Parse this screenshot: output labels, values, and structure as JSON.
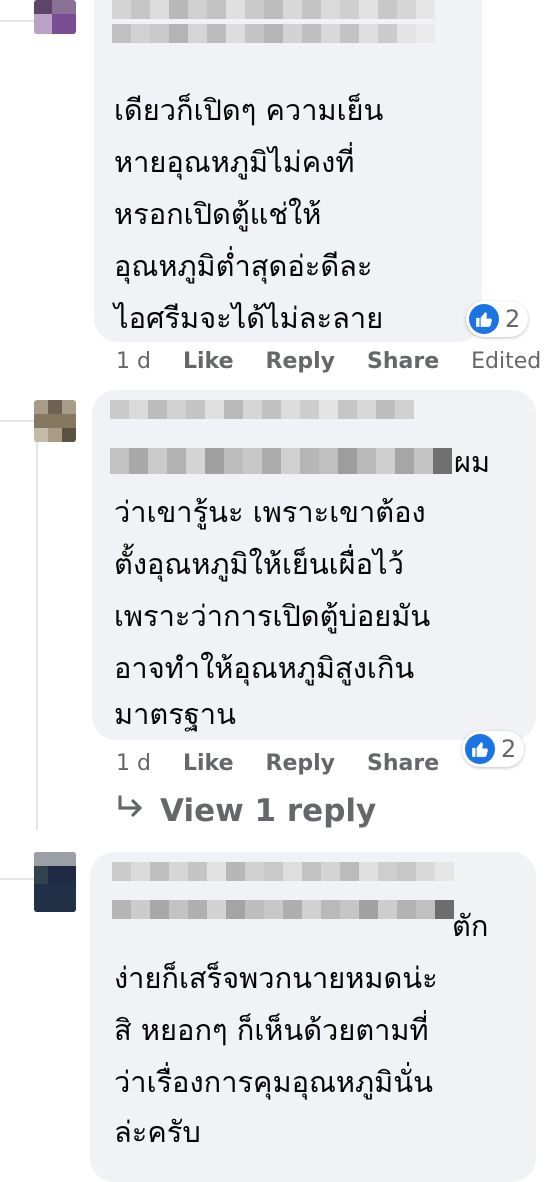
{
  "comments": [
    {
      "name_blurred": true,
      "text_lines": [
        "เดียวก็เปิดๆ ความเย็น",
        "หายอุณหภูมิไม่คงที่",
        "หรอกเปิดตู้แช่ให้",
        "อุณหภูมิต่ำสุดอ่ะดีละ",
        "ไอศรีมจะได้ไม่ละลาย"
      ],
      "reaction_count": "2",
      "reaction_icon": "like-icon",
      "time": "1 d",
      "like_label": "Like",
      "reply_label": "Reply",
      "share_label": "Share",
      "edited_label": "Edited"
    },
    {
      "name_blurred": true,
      "inline_word": "ผม",
      "text_lines": [
        "ว่าเขารู้นะ เพราะเขาต้อง",
        "ตั้งอุณหภูมิให้เย็นเผื่อไว้",
        "เพราะว่าการเปิดตู้บ่อยมัน",
        "อาจทำให้อุณหภูมิสูงเกิน",
        "มาตรฐาน"
      ],
      "reaction_count": "2",
      "reaction_icon": "like-icon",
      "time": "1 d",
      "like_label": "Like",
      "reply_label": "Reply",
      "share_label": "Share",
      "view_replies_label": "View 1 reply",
      "view_replies_icon": "reply-arrow-icon"
    },
    {
      "name_blurred": true,
      "inline_word": "ตัก",
      "text_lines": [
        "ง่ายก็เสร็จพวกนายหมดน่ะ",
        "สิ หยอกๆ ก็เห็นด้วยตามที่",
        "ว่าเรื่องการคุมอุณหภูมินั่น",
        "ล่ะครับ"
      ]
    }
  ],
  "colors": {
    "bubble": "#f0f2f5",
    "meta_text": "#65676b",
    "like_blue": "#1b74e4",
    "text": "#050505"
  }
}
